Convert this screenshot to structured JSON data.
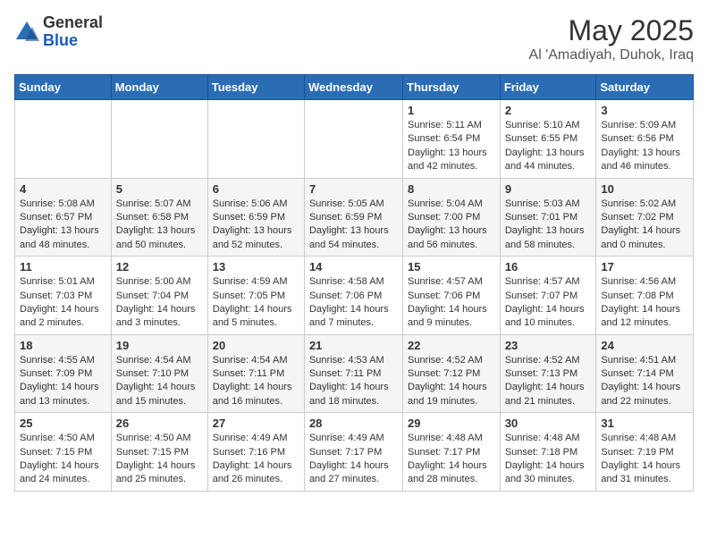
{
  "header": {
    "logo_general": "General",
    "logo_blue": "Blue",
    "month_year": "May 2025",
    "location": "Al 'Amadiyah, Duhok, Iraq"
  },
  "calendar": {
    "days_of_week": [
      "Sunday",
      "Monday",
      "Tuesday",
      "Wednesday",
      "Thursday",
      "Friday",
      "Saturday"
    ],
    "weeks": [
      [
        {
          "day": "",
          "info": ""
        },
        {
          "day": "",
          "info": ""
        },
        {
          "day": "",
          "info": ""
        },
        {
          "day": "",
          "info": ""
        },
        {
          "day": "1",
          "info": "Sunrise: 5:11 AM\nSunset: 6:54 PM\nDaylight: 13 hours\nand 42 minutes."
        },
        {
          "day": "2",
          "info": "Sunrise: 5:10 AM\nSunset: 6:55 PM\nDaylight: 13 hours\nand 44 minutes."
        },
        {
          "day": "3",
          "info": "Sunrise: 5:09 AM\nSunset: 6:56 PM\nDaylight: 13 hours\nand 46 minutes."
        }
      ],
      [
        {
          "day": "4",
          "info": "Sunrise: 5:08 AM\nSunset: 6:57 PM\nDaylight: 13 hours\nand 48 minutes."
        },
        {
          "day": "5",
          "info": "Sunrise: 5:07 AM\nSunset: 6:58 PM\nDaylight: 13 hours\nand 50 minutes."
        },
        {
          "day": "6",
          "info": "Sunrise: 5:06 AM\nSunset: 6:59 PM\nDaylight: 13 hours\nand 52 minutes."
        },
        {
          "day": "7",
          "info": "Sunrise: 5:05 AM\nSunset: 6:59 PM\nDaylight: 13 hours\nand 54 minutes."
        },
        {
          "day": "8",
          "info": "Sunrise: 5:04 AM\nSunset: 7:00 PM\nDaylight: 13 hours\nand 56 minutes."
        },
        {
          "day": "9",
          "info": "Sunrise: 5:03 AM\nSunset: 7:01 PM\nDaylight: 13 hours\nand 58 minutes."
        },
        {
          "day": "10",
          "info": "Sunrise: 5:02 AM\nSunset: 7:02 PM\nDaylight: 14 hours\nand 0 minutes."
        }
      ],
      [
        {
          "day": "11",
          "info": "Sunrise: 5:01 AM\nSunset: 7:03 PM\nDaylight: 14 hours\nand 2 minutes."
        },
        {
          "day": "12",
          "info": "Sunrise: 5:00 AM\nSunset: 7:04 PM\nDaylight: 14 hours\nand 3 minutes."
        },
        {
          "day": "13",
          "info": "Sunrise: 4:59 AM\nSunset: 7:05 PM\nDaylight: 14 hours\nand 5 minutes."
        },
        {
          "day": "14",
          "info": "Sunrise: 4:58 AM\nSunset: 7:06 PM\nDaylight: 14 hours\nand 7 minutes."
        },
        {
          "day": "15",
          "info": "Sunrise: 4:57 AM\nSunset: 7:06 PM\nDaylight: 14 hours\nand 9 minutes."
        },
        {
          "day": "16",
          "info": "Sunrise: 4:57 AM\nSunset: 7:07 PM\nDaylight: 14 hours\nand 10 minutes."
        },
        {
          "day": "17",
          "info": "Sunrise: 4:56 AM\nSunset: 7:08 PM\nDaylight: 14 hours\nand 12 minutes."
        }
      ],
      [
        {
          "day": "18",
          "info": "Sunrise: 4:55 AM\nSunset: 7:09 PM\nDaylight: 14 hours\nand 13 minutes."
        },
        {
          "day": "19",
          "info": "Sunrise: 4:54 AM\nSunset: 7:10 PM\nDaylight: 14 hours\nand 15 minutes."
        },
        {
          "day": "20",
          "info": "Sunrise: 4:54 AM\nSunset: 7:11 PM\nDaylight: 14 hours\nand 16 minutes."
        },
        {
          "day": "21",
          "info": "Sunrise: 4:53 AM\nSunset: 7:11 PM\nDaylight: 14 hours\nand 18 minutes."
        },
        {
          "day": "22",
          "info": "Sunrise: 4:52 AM\nSunset: 7:12 PM\nDaylight: 14 hours\nand 19 minutes."
        },
        {
          "day": "23",
          "info": "Sunrise: 4:52 AM\nSunset: 7:13 PM\nDaylight: 14 hours\nand 21 minutes."
        },
        {
          "day": "24",
          "info": "Sunrise: 4:51 AM\nSunset: 7:14 PM\nDaylight: 14 hours\nand 22 minutes."
        }
      ],
      [
        {
          "day": "25",
          "info": "Sunrise: 4:50 AM\nSunset: 7:15 PM\nDaylight: 14 hours\nand 24 minutes."
        },
        {
          "day": "26",
          "info": "Sunrise: 4:50 AM\nSunset: 7:15 PM\nDaylight: 14 hours\nand 25 minutes."
        },
        {
          "day": "27",
          "info": "Sunrise: 4:49 AM\nSunset: 7:16 PM\nDaylight: 14 hours\nand 26 minutes."
        },
        {
          "day": "28",
          "info": "Sunrise: 4:49 AM\nSunset: 7:17 PM\nDaylight: 14 hours\nand 27 minutes."
        },
        {
          "day": "29",
          "info": "Sunrise: 4:48 AM\nSunset: 7:17 PM\nDaylight: 14 hours\nand 28 minutes."
        },
        {
          "day": "30",
          "info": "Sunrise: 4:48 AM\nSunset: 7:18 PM\nDaylight: 14 hours\nand 30 minutes."
        },
        {
          "day": "31",
          "info": "Sunrise: 4:48 AM\nSunset: 7:19 PM\nDaylight: 14 hours\nand 31 minutes."
        }
      ]
    ]
  }
}
